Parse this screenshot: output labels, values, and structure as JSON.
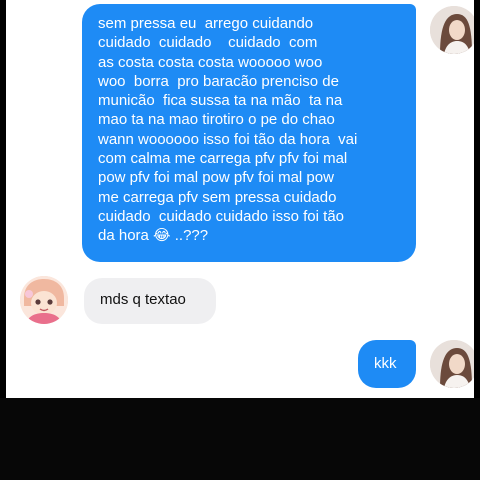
{
  "conversation": {
    "messages": [
      {
        "sender": "self",
        "lines": [
          "sem pressa eu  arrego cuidando",
          "cuidado  cuidado    cuidado  com",
          "as costa costa costa wooooo woo",
          "woo  borra  pro baracão prenciso de",
          "municão  fica sussa ta na mão  ta na",
          "mao ta na mao tirotiro o pe do chao",
          "wann woooooo isso foi tão da hora  vai",
          "com calma me carrega pfv pfv foi mal",
          "pow pfv foi mal pow pfv foi mal pow",
          "me carrega pfv sem pressa cuidado",
          "cuidado  cuidado cuidado isso foi tão",
          "da hora 😂 ..???"
        ]
      },
      {
        "sender": "other",
        "text": "mds q textao"
      },
      {
        "sender": "self",
        "text": "kkk"
      }
    ]
  },
  "colors": {
    "outgoing_bubble": "#1e8bf5",
    "incoming_bubble": "#efeff1",
    "background": "#ffffff",
    "bottom_bar": "#070707"
  },
  "icons": {
    "self_avatar": "profile-photo",
    "other_avatar": "cartoon-girl-avatar"
  }
}
